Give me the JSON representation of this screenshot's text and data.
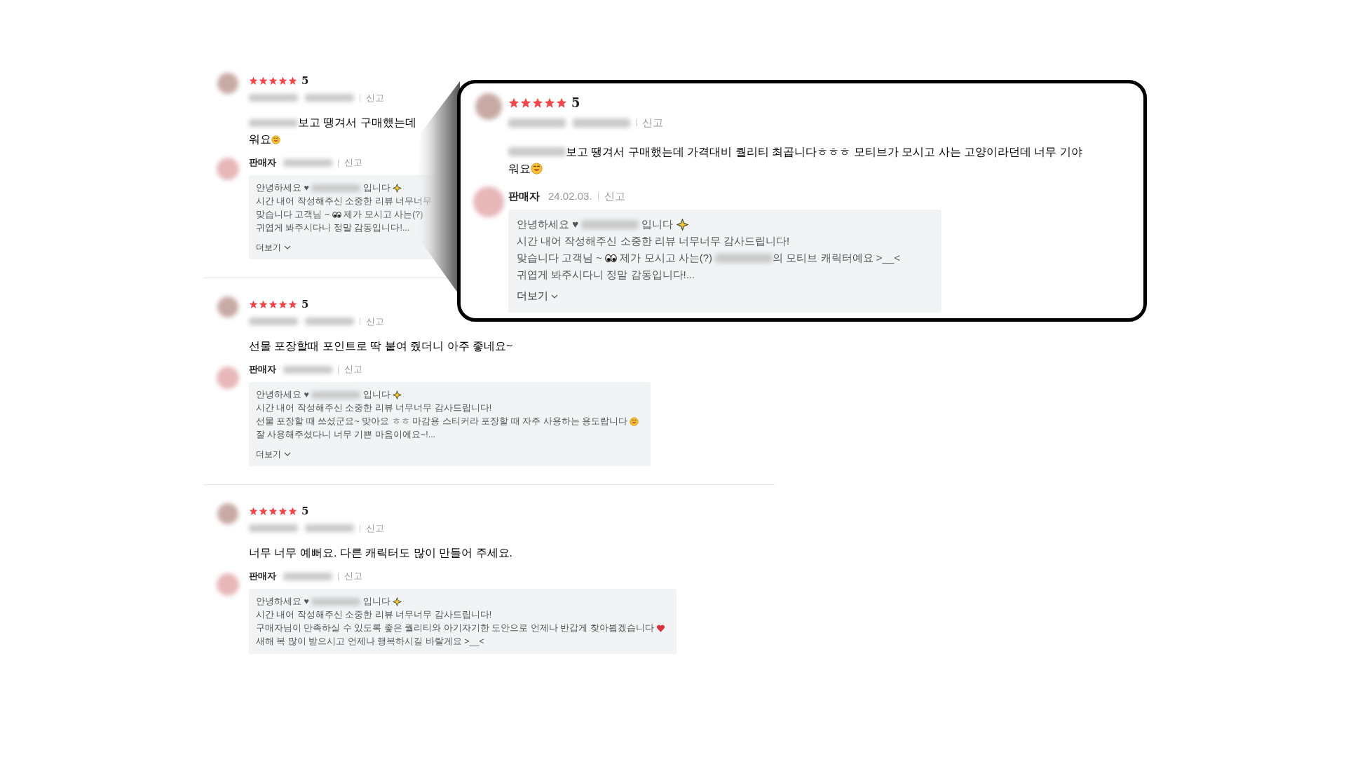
{
  "reviews": [
    {
      "stars": 5,
      "rating": "5",
      "report": "신고",
      "body": [
        [
          {
            "kind": "blur"
          },
          {
            "kind": "text",
            "text": "보고 땡겨서 구매했는데"
          }
        ],
        [
          {
            "kind": "text",
            "text": "워요"
          },
          {
            "kind": "smile"
          }
        ]
      ],
      "seller": {
        "label": "판매자",
        "report": "신고"
      },
      "reply": [
        [
          {
            "kind": "text",
            "text": "안녕하세요 ♥ "
          },
          {
            "kind": "blur"
          },
          {
            "kind": "text",
            "text": " 입니다 "
          },
          {
            "kind": "sparkle"
          }
        ],
        [
          {
            "kind": "text",
            "text": "시간 내어 작성해주신 소중한 리뷰 너무너무"
          }
        ],
        [
          {
            "kind": "text",
            "text": "맞습니다 고객님 ~ "
          },
          {
            "kind": "eyes"
          },
          {
            "kind": "text",
            "text": " 제가 모시고 사는(?)"
          }
        ],
        [
          {
            "kind": "text",
            "text": "귀엽게 봐주시다니 정말 감동입니다!..."
          }
        ]
      ],
      "more": "더보기"
    },
    {
      "stars": 5,
      "rating": "5",
      "report": "신고",
      "body": [
        [
          {
            "kind": "text",
            "text": "선물 포장할때 포인트로 딱 붙여 줬더니 아주 좋네요~"
          }
        ]
      ],
      "seller": {
        "label": "판매자",
        "report": "신고"
      },
      "reply": [
        [
          {
            "kind": "text",
            "text": "안녕하세요 ♥ "
          },
          {
            "kind": "blur"
          },
          {
            "kind": "text",
            "text": " 입니다 "
          },
          {
            "kind": "sparkle"
          }
        ],
        [
          {
            "kind": "text",
            "text": "시간 내어 작성해주신 소중한 리뷰 너무너무 감사드립니다!"
          }
        ],
        [
          {
            "kind": "text",
            "text": "선물 포장할 때 쓰셨군요~ 맞아요 ㅎㅎ 마감용 스티커라 포장할 때 자주 사용하는 용도랍니다 "
          },
          {
            "kind": "smile"
          }
        ],
        [
          {
            "kind": "text",
            "text": "잘 사용해주셨다니 너무 기쁜 마음이에요~!..."
          }
        ]
      ],
      "more": "더보기"
    },
    {
      "stars": 5,
      "rating": "5",
      "report": "신고",
      "body": [
        [
          {
            "kind": "text",
            "text": "너무 너무 예뻐요. 다른 캐릭터도 많이 만들어 주세요."
          }
        ]
      ],
      "seller": {
        "label": "판매자",
        "report": "신고"
      },
      "reply": [
        [
          {
            "kind": "text",
            "text": "안녕하세요 ♥ "
          },
          {
            "kind": "blur"
          },
          {
            "kind": "text",
            "text": " 입니다 "
          },
          {
            "kind": "sparkle"
          }
        ],
        [
          {
            "kind": "text",
            "text": "시간 내어 작성해주신 소중한 리뷰 너무너무 감사드립니다!"
          }
        ],
        [
          {
            "kind": "text",
            "text": "구매자님이 만족하실 수 있도록 좋은 퀄리티와 아기자기한 도안으로 언제나 반갑게 찾아뵙겠습니다 "
          },
          {
            "kind": "heart"
          }
        ],
        [
          {
            "kind": "text",
            "text": "새해 복 많이 받으시고 언제나 행복하시길 바랄게요 >__<"
          }
        ]
      ]
    }
  ],
  "callout": {
    "stars": 5,
    "rating": "5",
    "report": "신고",
    "body": [
      [
        {
          "kind": "blur"
        },
        {
          "kind": "text",
          "text": "보고 땡겨서 구매했는데 가격대비 퀄리티 최곱니다ㅎㅎㅎ 모티브가 모시고 사는 고양이라던데 너무 기야"
        }
      ],
      [
        {
          "kind": "text",
          "text": "워요"
        },
        {
          "kind": "smile"
        }
      ]
    ],
    "seller": {
      "label": "판매자",
      "date": "24.02.03.",
      "report": "신고"
    },
    "reply": [
      [
        {
          "kind": "text",
          "text": "안녕하세요 ♥ "
        },
        {
          "kind": "blur"
        },
        {
          "kind": "text",
          "text": " 입니다 "
        },
        {
          "kind": "sparkle"
        }
      ],
      [
        {
          "kind": "text",
          "text": "시간 내어 작성해주신 소중한 리뷰 너무너무 감사드립니다!"
        }
      ],
      [
        {
          "kind": "text",
          "text": "맞습니다 고객님 ~ "
        },
        {
          "kind": "eyes"
        },
        {
          "kind": "text",
          "text": " 제가 모시고 사는(?) "
        },
        {
          "kind": "blur"
        },
        {
          "kind": "text",
          "text": "의 모티브 캐릭터예요 >__<"
        }
      ],
      [
        {
          "kind": "text",
          "text": "귀엽게 봐주시다니 정말 감동입니다!..."
        }
      ]
    ],
    "more": "더보기"
  }
}
